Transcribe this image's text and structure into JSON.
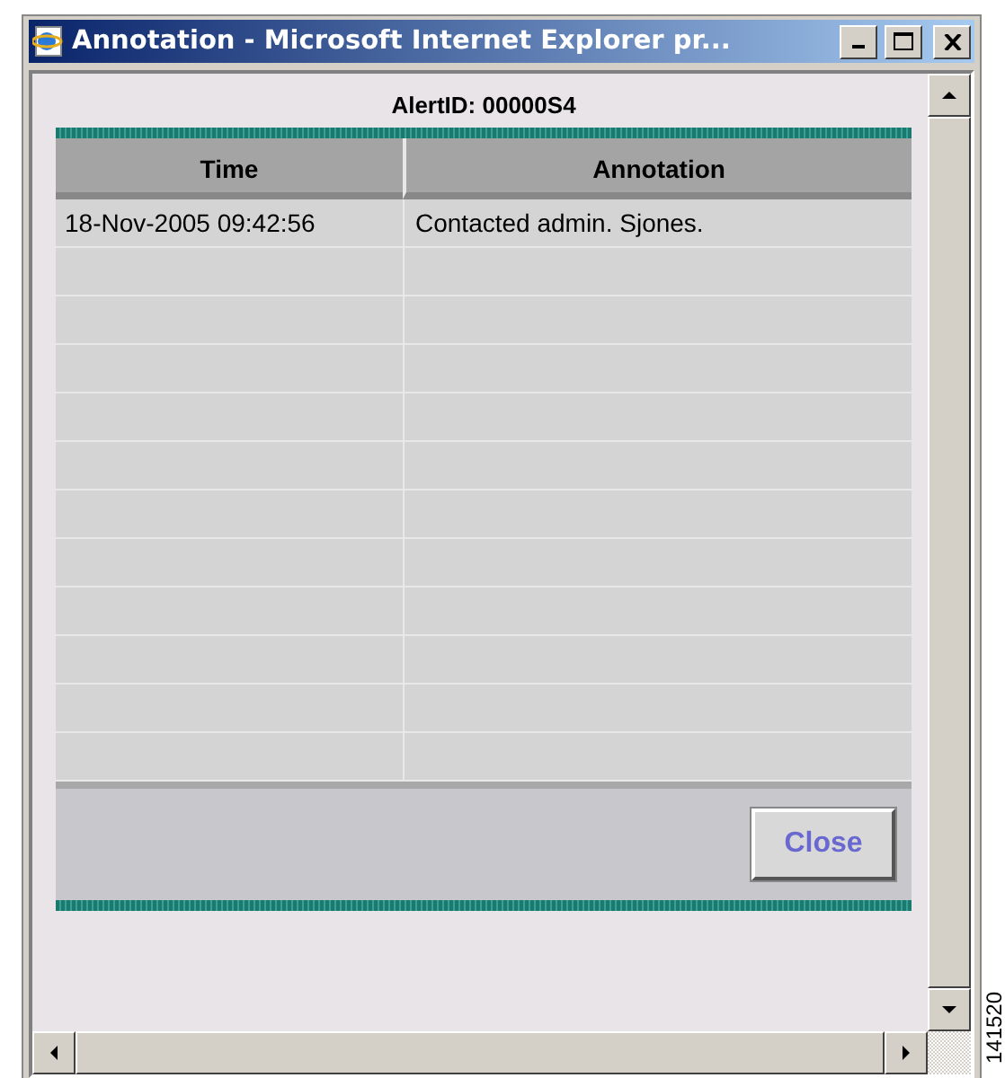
{
  "window": {
    "title": "Annotation - Microsoft Internet Explorer pr..."
  },
  "heading": "AlertID: 00000S4",
  "table": {
    "columns": [
      "Time",
      "Annotation"
    ],
    "rows": [
      {
        "time": "18-Nov-2005 09:42:56",
        "annotation": "Contacted admin. Sjones."
      }
    ]
  },
  "buttons": [
    "Close"
  ],
  "figure_number": "141520"
}
